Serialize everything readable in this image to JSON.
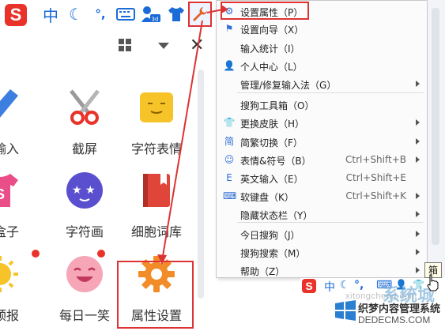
{
  "toolbar": {
    "logo": "S",
    "items": [
      {
        "name": "chinese-mode-icon",
        "glyph": "中"
      },
      {
        "name": "moon-icon",
        "glyph": "☾"
      },
      {
        "name": "punctuation-icon",
        "glyph": "°,"
      },
      {
        "name": "keyboard-icon",
        "glyph": "⌨"
      },
      {
        "name": "user-badge-icon",
        "glyph": "👤"
      },
      {
        "name": "shirt-icon",
        "glyph": "👕"
      },
      {
        "name": "wrench-icon",
        "glyph": "🔧"
      }
    ]
  },
  "panel": {
    "tiles": [
      {
        "label": "号输入"
      },
      {
        "label": "截屏"
      },
      {
        "label": "字符表情"
      },
      {
        "label": "快盒子"
      },
      {
        "label": "字符画"
      },
      {
        "label": "细胞词库"
      },
      {
        "label": "日预报"
      },
      {
        "label": "每日一笑"
      },
      {
        "label": "属性设置"
      }
    ]
  },
  "menu": {
    "items": [
      {
        "label": "设置属性（P）",
        "shortcut": "",
        "submenu": false,
        "icon": "⚙"
      },
      {
        "label": "设置向导（X）",
        "shortcut": "",
        "submenu": false,
        "icon": "⚑"
      },
      {
        "label": "输入统计（I）",
        "shortcut": "",
        "submenu": false,
        "icon": ""
      },
      {
        "label": "个人中心（L）",
        "shortcut": "",
        "submenu": false,
        "icon": "👤"
      },
      {
        "label": "管理/修复输入法（G）",
        "shortcut": "",
        "submenu": true,
        "icon": ""
      },
      {
        "label": "搜狗工具箱（O）",
        "shortcut": "",
        "submenu": false,
        "icon": ""
      },
      {
        "label": "更换皮肤（H）",
        "shortcut": "",
        "submenu": true,
        "icon": "👕"
      },
      {
        "label": "简繁切换（F）",
        "shortcut": "",
        "submenu": true,
        "icon": "简"
      },
      {
        "label": "表情&符号（B）",
        "shortcut": "Ctrl+Shift+B",
        "submenu": true,
        "icon": "☺"
      },
      {
        "label": "英文输入（E）",
        "shortcut": "Ctrl+Shift+E",
        "submenu": false,
        "icon": "E"
      },
      {
        "label": "软键盘（K）",
        "shortcut": "Ctrl+Shift+K",
        "submenu": true,
        "icon": "⌨"
      },
      {
        "label": "隐藏状态栏（Y）",
        "shortcut": "",
        "submenu": true,
        "icon": ""
      },
      {
        "label": "今日搜狗（J）",
        "shortcut": "",
        "submenu": true,
        "icon": ""
      },
      {
        "label": "搜狗搜索（M）",
        "shortcut": "",
        "submenu": true,
        "icon": ""
      },
      {
        "label": "帮助（Z）",
        "shortcut": "",
        "submenu": true,
        "icon": ""
      }
    ]
  },
  "bottom": {
    "logo": "S",
    "tooltip": "箱",
    "url": "xitongcheng.com",
    "watermark_title": "织梦内容管理系统",
    "watermark_site": "DEDECMS.COM",
    "watermark_brand": "系统城"
  },
  "colors": {
    "accent": "#1a6ad8",
    "highlight": "#dd3333",
    "orange": "#f28c28"
  }
}
